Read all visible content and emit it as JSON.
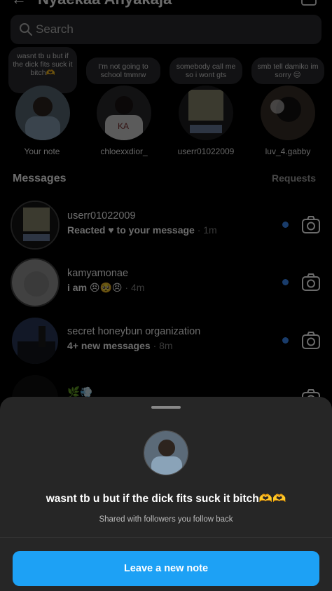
{
  "header": {
    "title": "Nyaekaa Anyakaja"
  },
  "search": {
    "placeholder": "Search"
  },
  "notes": [
    {
      "text": "wasnt tb u but if the dick fits suck it bitch🫶",
      "label": "Your note"
    },
    {
      "text": "I'm not going to school tmmrw",
      "label": "chloexxdior_"
    },
    {
      "text": "somebody call me so i wont gts",
      "label": "userr01022009"
    },
    {
      "text": "smb tell damiko im sorry 😔",
      "label": "luv_4.gabby"
    }
  ],
  "inbox": {
    "messages_label": "Messages",
    "requests_label": "Requests",
    "threads": [
      {
        "name": "userr01022009",
        "preview": "Reacted ♥ to your message",
        "time": " · 1m",
        "unread": true
      },
      {
        "name": "kamyamonae",
        "preview": "i am 😠🥺😠",
        "time": " · 4m",
        "unread": true
      },
      {
        "name": "secret honeybun organization",
        "preview": "4+ new messages",
        "time": " · 8m",
        "unread": true
      },
      {
        "name": "🌿💨",
        "preview": "",
        "time": "",
        "unread": false
      }
    ]
  },
  "sheet": {
    "note_text": "wasnt tb u but if the dick fits suck it bitch🫶🫶",
    "subtitle": "Shared with followers you follow back",
    "button_label": "Leave a new note"
  },
  "colors": {
    "accent": "#1da1f5",
    "unread_dot": "#3b8fff",
    "sheet_bg": "#262626",
    "search_bg": "#2b2c30"
  }
}
